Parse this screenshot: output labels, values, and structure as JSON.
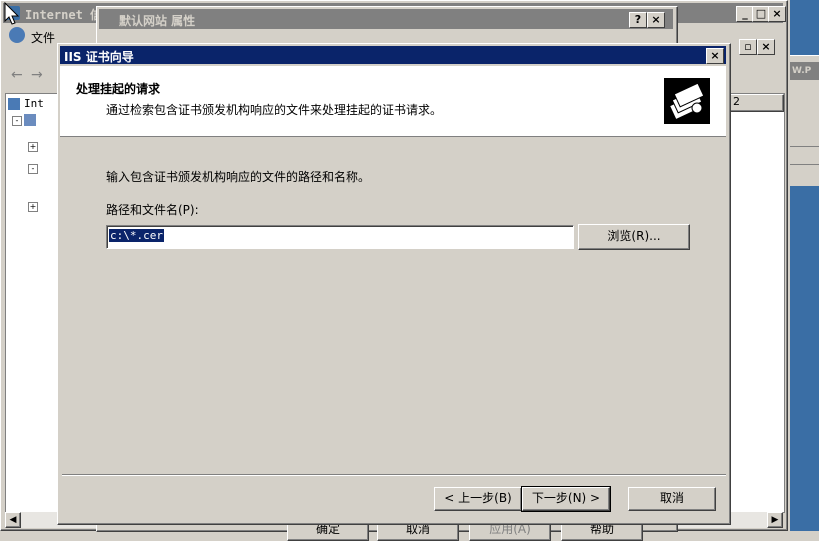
{
  "mmc": {
    "title": "Internet 信",
    "menu_file": "文件",
    "tree_root": "Int",
    "right_header": "2",
    "side_text": "W.P"
  },
  "props": {
    "title": "默认网站 属性",
    "help_btn": "?",
    "close_btn": "×",
    "btn_ok": "确定",
    "btn_cancel": "取消",
    "btn_apply": "应用(A)",
    "btn_help": "帮助"
  },
  "wizard": {
    "title": "IIS 证书向导",
    "close_btn": "×",
    "header_title": "处理挂起的请求",
    "header_desc": "通过检索包含证书颁发机构响应的文件来处理挂起的证书请求。",
    "instruction": "输入包含证书颁发机构响应的文件的路径和名称。",
    "path_label": "路径和文件名(P):",
    "path_value": "c:\\*.cer",
    "browse_btn": "浏览(R)...",
    "back_btn": "< 上一步(B)",
    "next_btn": "下一步(N) >",
    "cancel_btn": "取消"
  },
  "colors": {
    "titlebar_active": "#0a246a",
    "face": "#d4d0c8",
    "selection": "#0a246a"
  }
}
